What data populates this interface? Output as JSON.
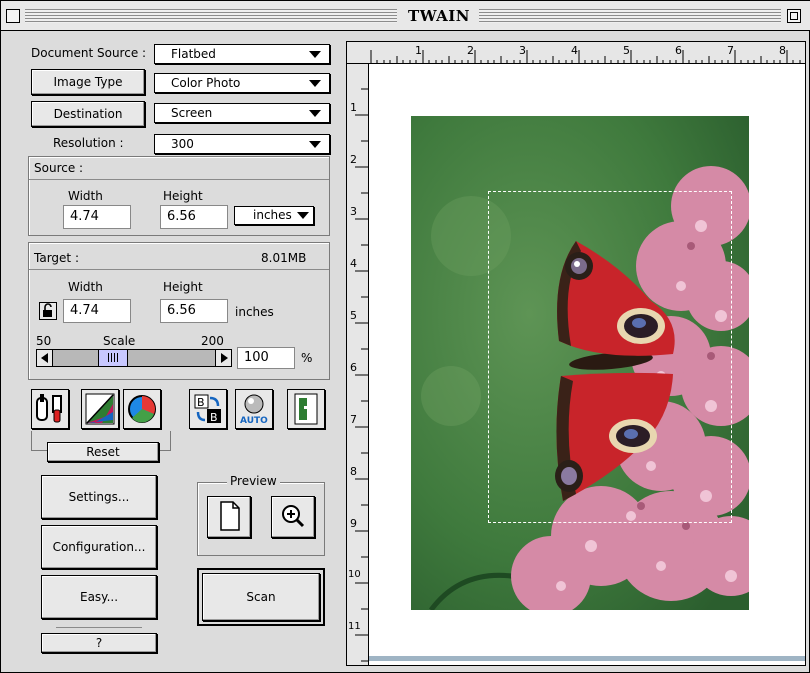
{
  "window": {
    "title": "TWAIN"
  },
  "document_source": {
    "label": "Document Source :",
    "value": "Flatbed"
  },
  "image_type": {
    "button_label": "Image Type",
    "value": "Color Photo"
  },
  "destination": {
    "button_label": "Destination",
    "value": "Screen"
  },
  "resolution": {
    "label": "Resolution :",
    "value": "300"
  },
  "source": {
    "heading": "Source :",
    "width_label": "Width",
    "height_label": "Height",
    "width": "4.74",
    "height": "6.56",
    "units": "inches"
  },
  "target": {
    "heading": "Target :",
    "size": "8.01MB",
    "width_label": "Width",
    "height_label": "Height",
    "width": "4.74",
    "height": "6.56",
    "units": "inches",
    "scale_label": "Scale",
    "scale_min": "50",
    "scale_max": "200",
    "scale_value": "100",
    "percent_sign": "%"
  },
  "tools": {
    "reset_label": "Reset",
    "icons": [
      "tools-icon",
      "levels-icon",
      "color-wheel-icon",
      "black-white-icon",
      "auto-icon",
      "exit-icon"
    ],
    "auto_label": "AUTO"
  },
  "buttons": {
    "settings": "Settings...",
    "configuration": "Configuration...",
    "easy": "Easy...",
    "help": "?",
    "scan": "Scan"
  },
  "preview": {
    "label": "Preview"
  },
  "ruler": {
    "top": [
      "1",
      "2",
      "3",
      "4",
      "5",
      "6",
      "7",
      "8"
    ],
    "left": [
      "1",
      "2",
      "3",
      "4",
      "5",
      "6",
      "7",
      "8",
      "9",
      "10",
      "11"
    ]
  },
  "colors": {
    "panel": "#dcdcdc",
    "photo_background": "#3f7a3d",
    "butterfly_red": "#c8242a",
    "flowers": "#d58aa6"
  }
}
